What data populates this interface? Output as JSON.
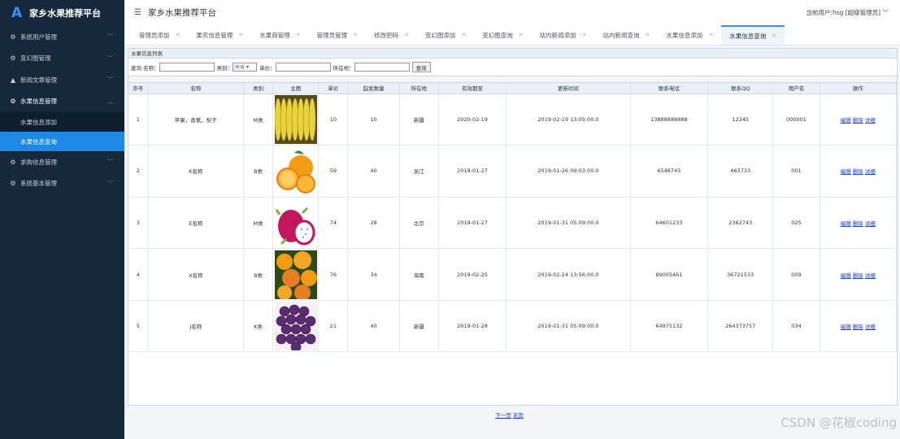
{
  "brand": {
    "logo": "A",
    "title": "家乡水果推荐平台"
  },
  "sidebar": {
    "items": [
      {
        "label": "系统用户管理",
        "icon": "gear-icon"
      },
      {
        "label": "变幻图管理",
        "icon": "gear-icon"
      },
      {
        "label": "新闻文章管理",
        "icon": "user-icon"
      },
      {
        "label": "水果信息管理",
        "icon": "gear-icon",
        "open": true,
        "children": [
          {
            "label": "水果信息添加"
          },
          {
            "label": "水果信息查询",
            "active": true
          }
        ]
      },
      {
        "label": "求购信息管理",
        "icon": "gear-icon"
      },
      {
        "label": "系统基本管理",
        "icon": "gear-icon"
      }
    ]
  },
  "header": {
    "title": "家乡水果推荐平台",
    "user": "当前用户:hsg [超级管理员]"
  },
  "tabs": [
    {
      "label": "管理员添加"
    },
    {
      "label": "果农信息管理"
    },
    {
      "label": "水果商管理"
    },
    {
      "label": "管理员管理"
    },
    {
      "label": "修改密码"
    },
    {
      "label": "变幻图添加"
    },
    {
      "label": "变幻图查询"
    },
    {
      "label": "站内新闻添加"
    },
    {
      "label": "站内新闻查询"
    },
    {
      "label": "水果信息添加"
    },
    {
      "label": "水果信息查询",
      "active": true
    }
  ],
  "panel": {
    "title": "水果信息列表"
  },
  "search": {
    "query_label": "查询",
    "name_label": "名称：",
    "category_label": "类别：",
    "category_value": "所有",
    "price_label": "单价：",
    "location_label": "所在地：",
    "button": "查询"
  },
  "table": {
    "headers": [
      "序号",
      "名称",
      "类别",
      "主图",
      "单价",
      "起发数量",
      "所在地",
      "有效期至",
      "更新时间",
      "联系电话",
      "联系QQ",
      "用户名",
      "操作"
    ],
    "rows": [
      {
        "no": "1",
        "name": "苹果，香蕉，梨子",
        "category": "M类",
        "image": "banana",
        "price": "10",
        "min_qty": "10",
        "location": "新疆",
        "expiry": "2020-02-19",
        "updated": "2019-02-19 13:05:00.0",
        "phone": "13888888888",
        "qq": "12345",
        "user": "000001"
      },
      {
        "no": "2",
        "name": "K名称",
        "category": "B类",
        "image": "orange",
        "price": "59",
        "min_qty": "40",
        "location": "浙江",
        "expiry": "2019-01-27",
        "updated": "2019-01-26 09:03:00.0",
        "phone": "6548745",
        "qq": "463733",
        "user": "001"
      },
      {
        "no": "3",
        "name": "E名称",
        "category": "M类",
        "image": "dragonfruit",
        "price": "74",
        "min_qty": "28",
        "location": "北京",
        "expiry": "2019-01-27",
        "updated": "2019-01-31 05:09:00.0",
        "phone": "64601233",
        "qq": "2362743",
        "user": "025"
      },
      {
        "no": "4",
        "name": "X名称",
        "category": "B类",
        "image": "tangerine",
        "price": "76",
        "min_qty": "34",
        "location": "海南",
        "expiry": "2019-02-25",
        "updated": "2019-02-24 13:56:00.0",
        "phone": "89005461",
        "qq": "36721533",
        "user": "009"
      },
      {
        "no": "5",
        "name": "J名称",
        "category": "K类",
        "image": "grape",
        "price": "21",
        "min_qty": "40",
        "location": "新疆",
        "expiry": "2019-01-28",
        "updated": "2019-01-31 05:09:00.0",
        "phone": "64975132",
        "qq": "264373757",
        "user": "034"
      }
    ],
    "actions": {
      "edit": "编辑",
      "delete": "删除",
      "detail": "详细"
    }
  },
  "pager": {
    "next": "下一页",
    "last": "末页"
  },
  "watermark": "CSDN @花椒coding",
  "colors": {
    "sidebar": "#15283c",
    "accent": "#1e88e5",
    "link": "#1a3bd6"
  }
}
